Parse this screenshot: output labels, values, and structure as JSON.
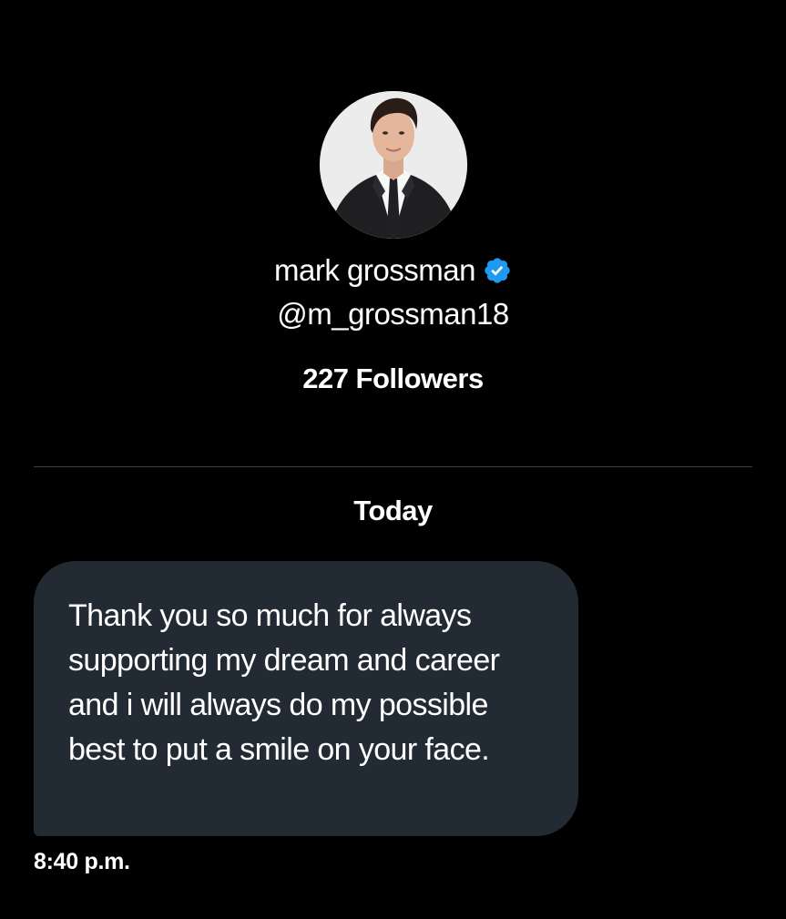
{
  "profile": {
    "display_name": "mark grossman",
    "verified_badge": "verified-badge-icon",
    "handle": "@m_grossman18",
    "followers_count": "227",
    "followers_label": "Followers"
  },
  "conversation": {
    "day_separator": "Today",
    "messages": [
      {
        "text": "Thank you so much for always supporting my dream and career and i will always do my possible best to put a smile on your face.",
        "time": "8:40 p.m."
      }
    ]
  },
  "colors": {
    "background": "#000000",
    "bubble": "#222b33",
    "verified": "#1d9bf0",
    "divider": "#3e4144"
  }
}
